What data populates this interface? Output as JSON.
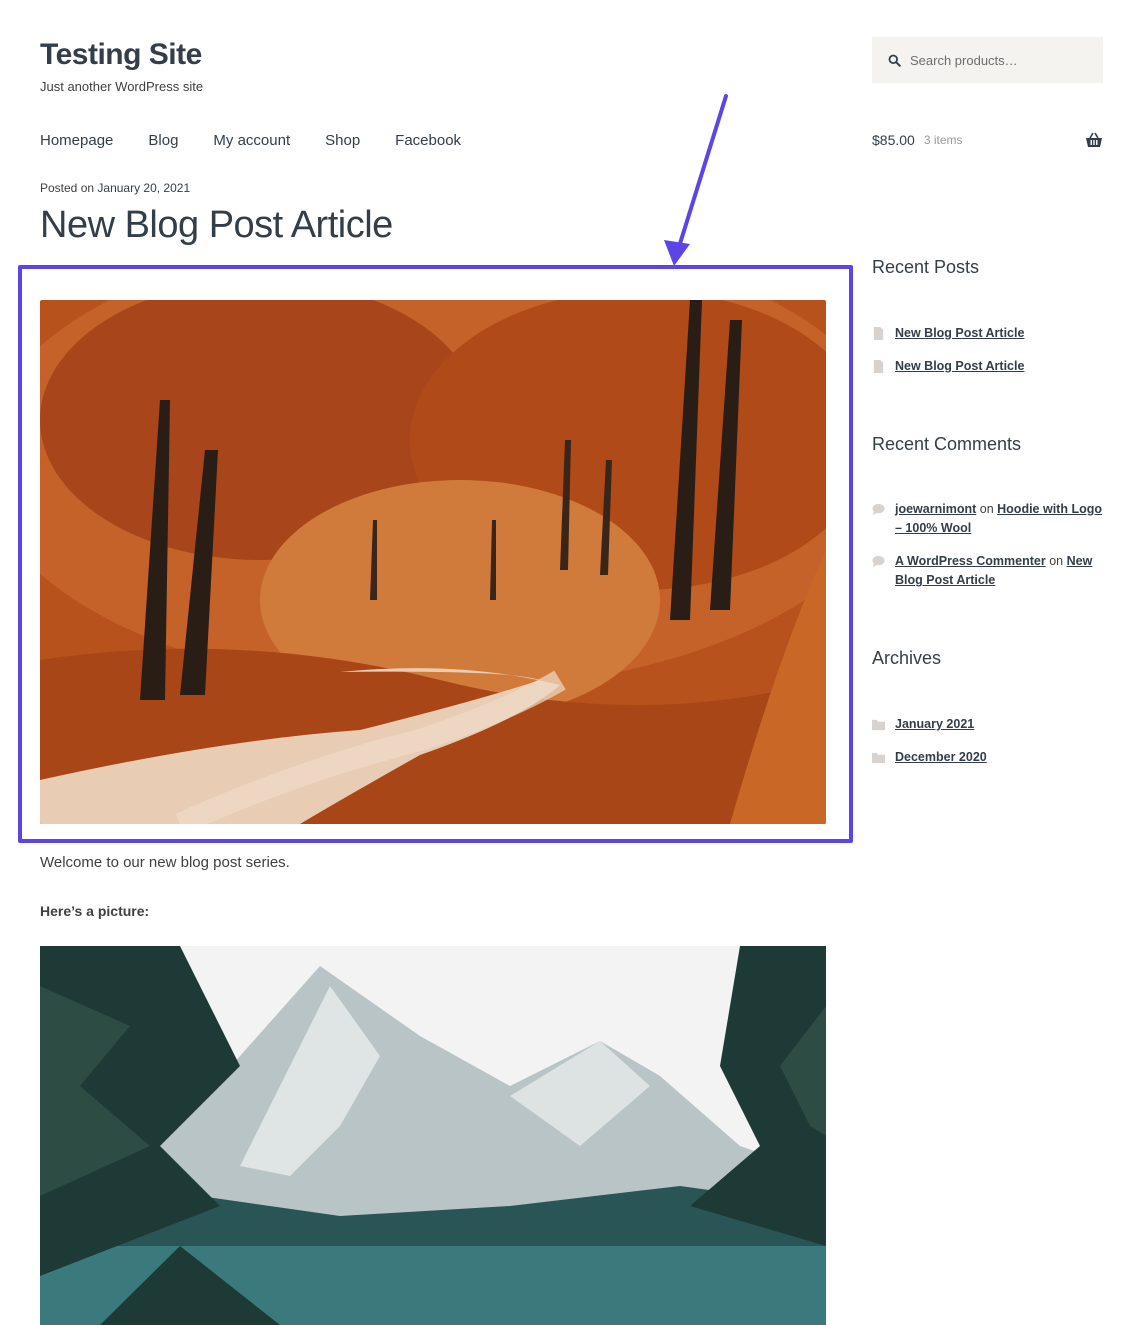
{
  "header": {
    "site_title": "Testing Site",
    "site_description": "Just another WordPress site",
    "search": {
      "placeholder": "Search products…",
      "icon": "search-icon"
    }
  },
  "nav": {
    "items": [
      {
        "label": "Homepage"
      },
      {
        "label": "Blog"
      },
      {
        "label": "My account"
      },
      {
        "label": "Shop"
      },
      {
        "label": "Facebook"
      }
    ]
  },
  "cart": {
    "amount": "$85.00",
    "count": "3 items",
    "icon": "basket-icon"
  },
  "post": {
    "posted_prefix": "Posted on",
    "date": "January 20, 2021",
    "title": "New Blog Post Article",
    "intro": "Welcome to our new blog post series.",
    "picture_label": "Here’s a picture:"
  },
  "annotation": {
    "highlight_color": "#5b45e6"
  },
  "sidebar": {
    "recent_posts": {
      "title": "Recent Posts",
      "items": [
        {
          "label": "New Blog Post Article"
        },
        {
          "label": "New Blog Post Article"
        }
      ]
    },
    "recent_comments": {
      "title": "Recent Comments",
      "items": [
        {
          "author": "joewarnimont",
          "on": "on",
          "post": "Hoodie with Logo – 100% Wool"
        },
        {
          "author": "A WordPress Commenter",
          "on": "on",
          "post": "New Blog Post Article"
        }
      ]
    },
    "archives": {
      "title": "Archives",
      "items": [
        {
          "label": "January 2021"
        },
        {
          "label": "December 2020"
        }
      ]
    }
  },
  "colors": {
    "link": "#333e48",
    "text": "#404040",
    "accent": "#5b45e6"
  }
}
